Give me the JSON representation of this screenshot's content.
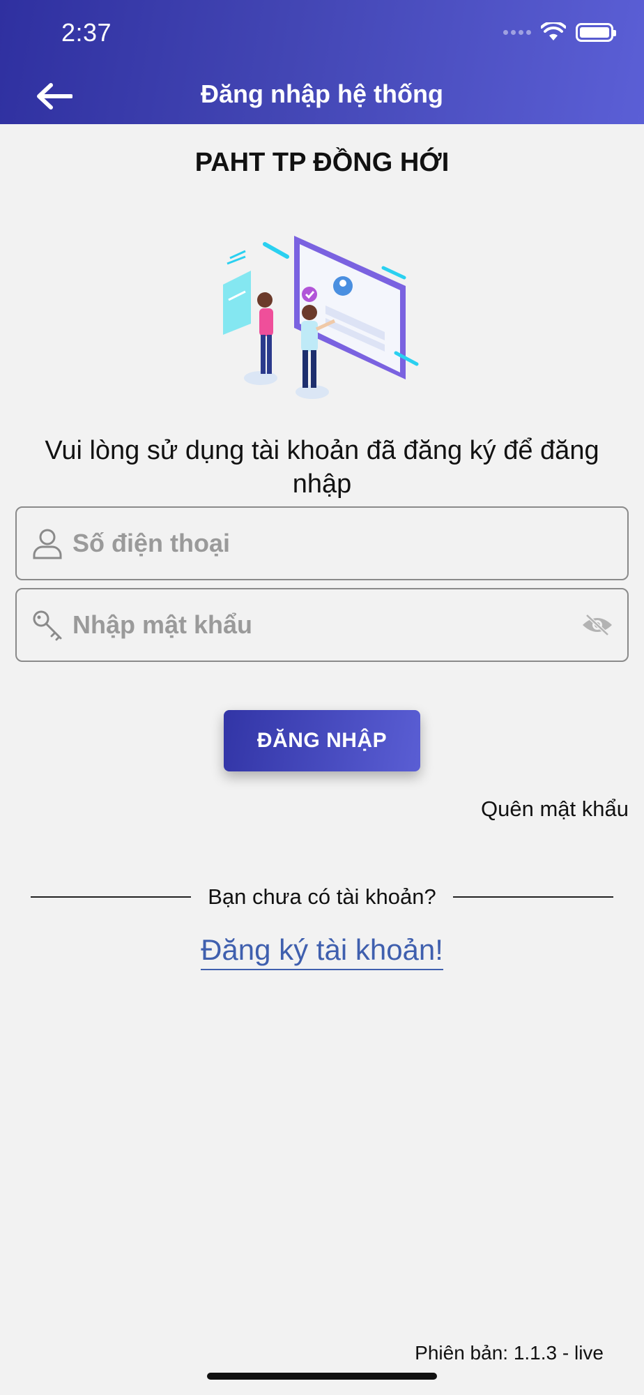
{
  "status_bar": {
    "time": "2:37"
  },
  "header": {
    "title": "Đăng nhập hệ thống"
  },
  "main": {
    "app_name": "PAHT TP ĐỒNG HỚI",
    "instruction": "Vui lòng sử dụng tài khoản đã đăng ký để đăng nhập",
    "phone_field": {
      "placeholder": "Số điện thoại",
      "value": ""
    },
    "password_field": {
      "placeholder": "Nhập mật khẩu",
      "value": ""
    },
    "login_label": "ĐĂNG NHẬP",
    "forgot_label": "Quên mật khẩu",
    "no_account_text": "Bạn chưa có tài khoản?",
    "register_label": "Đăng ký tài khoản!"
  },
  "footer": {
    "version": "Phiên bản: 1.1.3 - live"
  },
  "icons": [
    "back-arrow-icon",
    "user-icon",
    "key-icon",
    "eye-slash-icon",
    "wifi-icon",
    "battery-icon",
    "cellular-signal-icon"
  ],
  "colors": {
    "header_start": "#2f30a0",
    "header_end": "#5b5fd6",
    "link": "#3f5fae",
    "background": "#f2f2f2"
  }
}
